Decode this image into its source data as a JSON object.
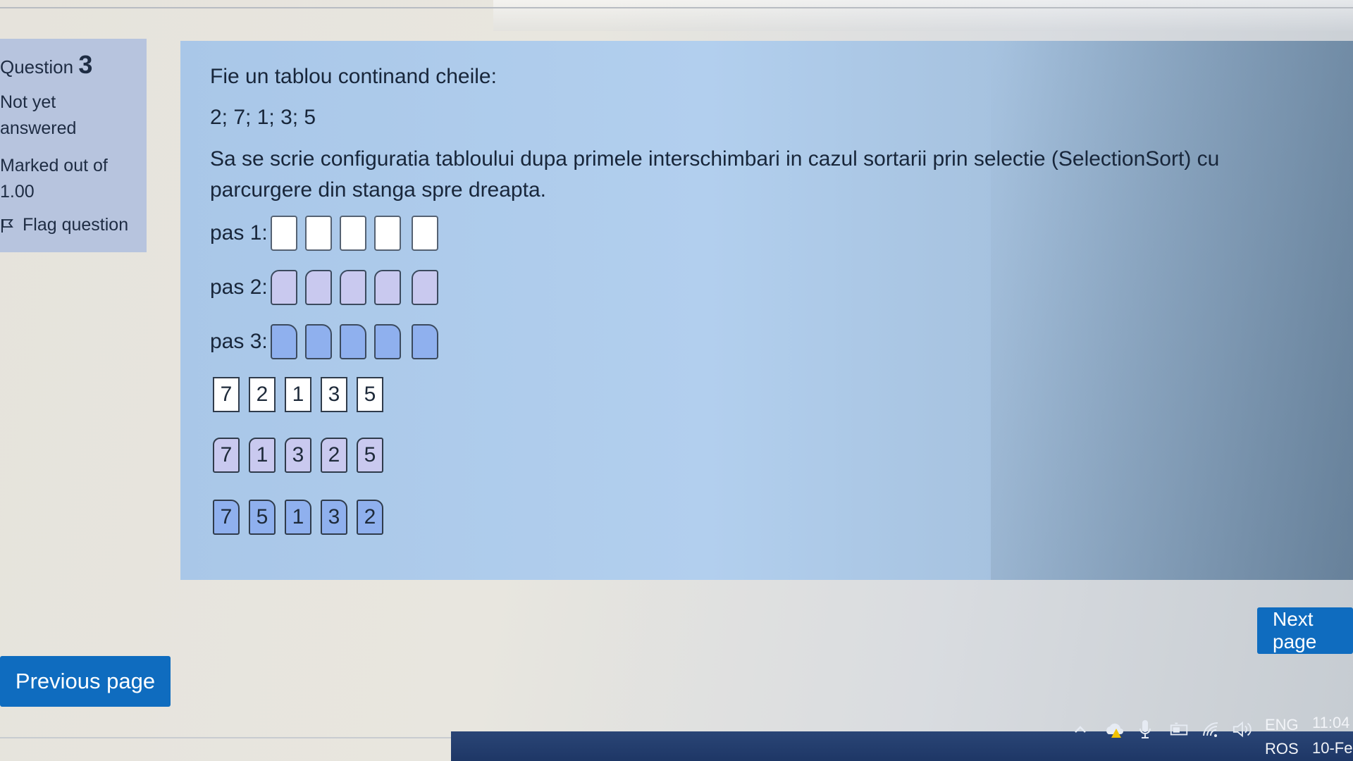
{
  "sidebar": {
    "question_prefix": "Question",
    "question_number": "3",
    "status_line1": "Not yet",
    "status_line2": "answered",
    "marked_line1": "Marked out of",
    "marked_line2": "1.00",
    "flag_label": "Flag question"
  },
  "question": {
    "intro": "Fie un tablou continand cheile:",
    "keys": "2; 7; 1; 3; 5",
    "prompt": "Sa se scrie configuratia tabloului dupa primele interschimbari in cazul sortarii prin selectie (SelectionSort) cu parcurgere din stanga spre dreapta.",
    "steps": [
      {
        "label": "pas 1:"
      },
      {
        "label": "pas 2:"
      },
      {
        "label": "pas 3:"
      }
    ],
    "tile_groups": [
      [
        "7",
        "2",
        "1",
        "3",
        "5"
      ],
      [
        "7",
        "1",
        "3",
        "2",
        "5"
      ],
      [
        "7",
        "5",
        "1",
        "3",
        "2"
      ]
    ]
  },
  "navigation": {
    "previous_label": "Previous page",
    "next_label": "Next page"
  },
  "taskbar": {
    "lang_top": "ENG",
    "lang_bottom": "ROS",
    "time": "11:04",
    "date": "10-Fe",
    "icons": [
      "chevron-up-icon",
      "cloud-warning-icon",
      "microphone-icon",
      "battery-icon",
      "wifi-icon",
      "speaker-icon"
    ]
  },
  "colors": {
    "accent": "#0f6cbf",
    "info_bg": "#b7c4de",
    "panel_bg": "#b2cfee",
    "group2_fill": "#c9c9ef",
    "group3_fill": "#8fb0ee"
  }
}
